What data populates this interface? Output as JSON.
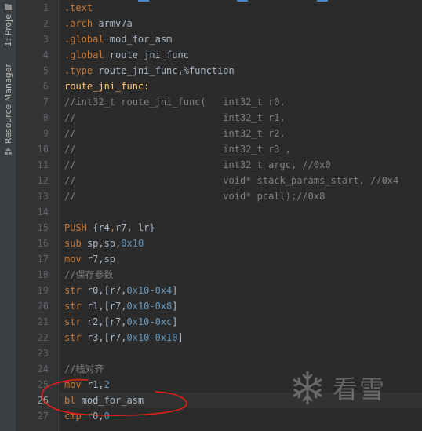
{
  "sidebar": {
    "project_tab": "1: Proje",
    "resource_tab": "Resource Manager"
  },
  "gutter": {
    "line_numbers": [
      "1",
      "2",
      "3",
      "4",
      "5",
      "6",
      "7",
      "8",
      "9",
      "10",
      "11",
      "12",
      "13",
      "14",
      "15",
      "16",
      "17",
      "18",
      "19",
      "20",
      "21",
      "22",
      "23",
      "24",
      "25",
      "26",
      "27"
    ]
  },
  "code": {
    "l1": ".text",
    "l2_a": ".arch",
    "l2_b": " armv7a",
    "l3_a": ".global",
    "l3_b": " mod_for_asm",
    "l4_a": ".global",
    "l4_b": " route_jni_func",
    "l5_a": ".type",
    "l5_b": " route_jni_func,%function",
    "l6": "route_jni_func:",
    "l7": "//int32_t route_jni_func(   int32_t r0,",
    "l8": "//                          int32_t r1,",
    "l9": "//                          int32_t r2,",
    "l10": "//                          int32_t r3 ,",
    "l11": "//                          int32_t argc, //0x0",
    "l12": "//                          void* stack_params_start, //0x4",
    "l13": "//                          void* pcall);//0x8",
    "l15_a": "PUSH",
    "l15_b": " {r4",
    "l15_c": ",",
    "l15_d": "r7",
    "l15_e": ", lr}",
    "l16_a": "sub",
    "l16_b": " sp,sp,",
    "l16_c": "0x10",
    "l17_a": "mov",
    "l17_b": " r7,sp",
    "l18": "//保存参数",
    "l19_a": "str",
    "l19_b": " r0,[r7,",
    "l19_c": "0x10-0x4",
    "l19_d": "]",
    "l20_a": "str",
    "l20_b": " r1,[r7,",
    "l20_c": "0x10-0x8",
    "l20_d": "]",
    "l21_a": "str",
    "l21_b": " r2,[r7,",
    "l21_c": "0x10-0xc",
    "l21_d": "]",
    "l22_a": "str",
    "l22_b": " r3,[r7,",
    "l22_c": "0x10-0x10",
    "l22_d": "]",
    "l24": "//栈对齐",
    "l25_a": "mov",
    "l25_b": " r1,",
    "l25_c": "2",
    "l26_a": "bl",
    "l26_b": " mod_for_asm",
    "l27_a": "cmp",
    "l27_b": " r0,",
    "l27_c": "0"
  },
  "watermark": {
    "text": "看雪"
  },
  "colors": {
    "background": "#2b2b2b",
    "keyword": "#cc7832",
    "number": "#6897bb",
    "comment": "#808080",
    "label": "#ffc66d",
    "annotation": "#e0221a"
  }
}
